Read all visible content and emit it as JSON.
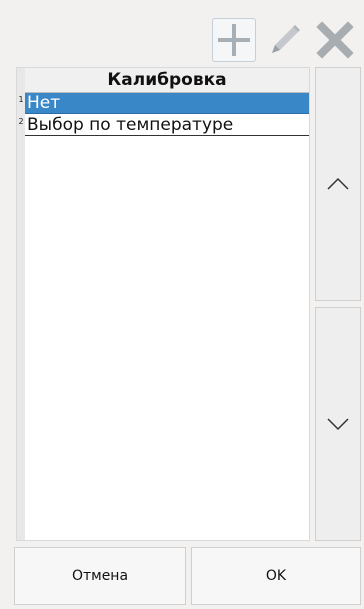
{
  "toolbar": {
    "add_icon": "plus-icon",
    "edit_icon": "pencil-icon",
    "delete_icon": "cross-icon",
    "colors": {
      "icon_gray": "#a8b0b8",
      "add_bg": "#f4f6f8"
    }
  },
  "table": {
    "header": "Калибровка",
    "rows": [
      {
        "num": "1",
        "label": "Нет",
        "selected": true
      },
      {
        "num": "2",
        "label": "Выбор по температуре",
        "selected": false
      }
    ],
    "selection_color": "#3a87c8"
  },
  "scroll": {
    "up_icon": "chevron-up-icon",
    "down_icon": "chevron-down-icon"
  },
  "footer": {
    "cancel_label": "Отмена",
    "ok_label": "OK"
  }
}
